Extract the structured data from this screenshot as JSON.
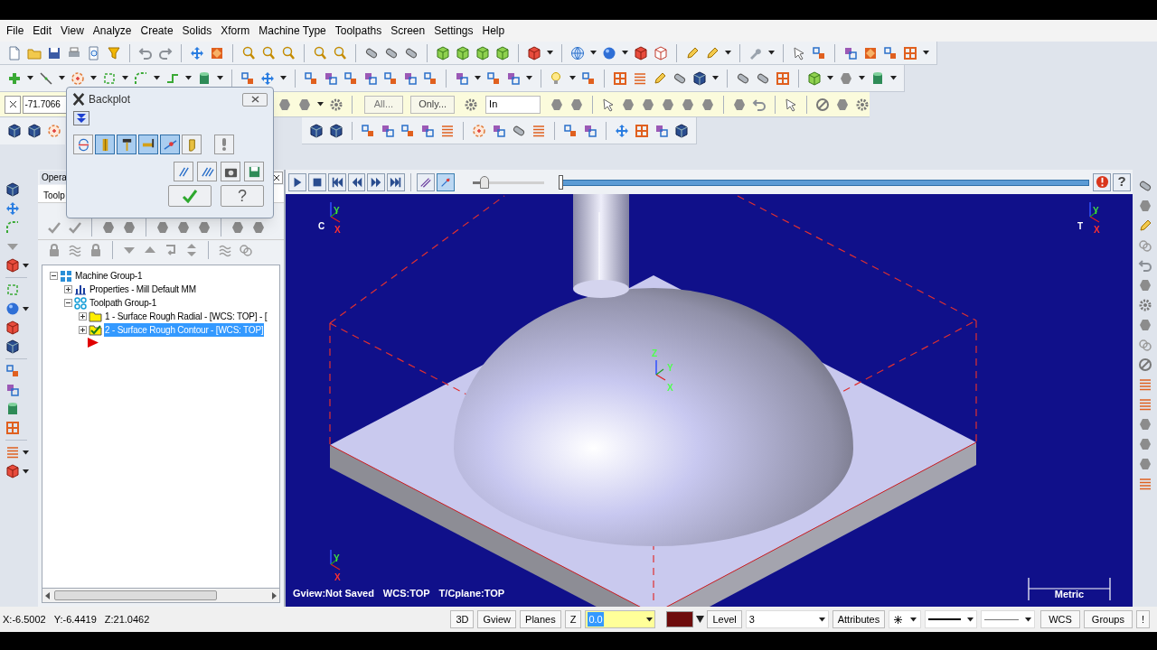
{
  "menu_bar": [
    "File",
    "Edit",
    "View",
    "Analyze",
    "Create",
    "Solids",
    "Xform",
    "Machine Type",
    "Toolpaths",
    "Screen",
    "Settings",
    "Help"
  ],
  "attribute_bar": {
    "x_value": "-71.7066",
    "select_all": "All...",
    "select_only": "Only...",
    "units": "In"
  },
  "backplot": {
    "title": "Backplot",
    "display_toggles": [
      {
        "pressed": false
      },
      {
        "pressed": true
      },
      {
        "pressed": true
      },
      {
        "pressed": true
      },
      {
        "pressed": true
      },
      {
        "pressed": false
      }
    ],
    "help_button": "?"
  },
  "operations_manager": {
    "title": "Opera",
    "tab": "Toolp",
    "tree": [
      {
        "kind": "machine",
        "label": "Machine Group-1",
        "expanded": true,
        "selected": false,
        "children": [
          {
            "kind": "properties",
            "label": "Properties - Mill Default MM",
            "expanded": false,
            "selected": false
          },
          {
            "kind": "toolpath_group",
            "label": "Toolpath Group-1",
            "expanded": true,
            "selected": false,
            "children": [
              {
                "kind": "operation",
                "label": "1 - Surface Rough Radial - [WCS: TOP] - [",
                "expanded": false,
                "checked": false,
                "selected": false
              },
              {
                "kind": "operation",
                "label": "2 - Surface Rough Contour - [WCS: TOP]",
                "expanded": false,
                "checked": true,
                "selected": true
              }
            ]
          }
        ]
      }
    ]
  },
  "playback": {
    "toggles": [
      {
        "pressed": false
      },
      {
        "pressed": true
      }
    ],
    "speed": {
      "level": 0.17
    },
    "position": {
      "level": 0
    },
    "help_button": "?"
  },
  "viewport": {
    "gnomons": [
      {
        "label": "C",
        "axes": [
          "Y",
          "X"
        ]
      },
      {
        "label": "T",
        "axes": [
          "Y",
          "X"
        ]
      },
      {
        "axes": [
          "Z",
          "Y",
          "X"
        ]
      },
      {
        "axes": [
          "Y",
          "X"
        ]
      }
    ],
    "status": [
      "Gview:Not Saved",
      "WCS:TOP",
      "T/Cplane:TOP"
    ],
    "scale_label": "Metric"
  },
  "status_bar": {
    "coordinates": [
      "X:-6.5002",
      "Y:-6.4419",
      "Z:21.0462"
    ],
    "view_buttons": [
      "3D",
      "Gview",
      "Planes"
    ],
    "z_label": "Z",
    "z_value": "0.0",
    "level_label": "Level",
    "level_value": "3",
    "attributes_button": "Attributes",
    "wcs_button": "WCS",
    "groups_button": "Groups",
    "alert_button": "!"
  }
}
